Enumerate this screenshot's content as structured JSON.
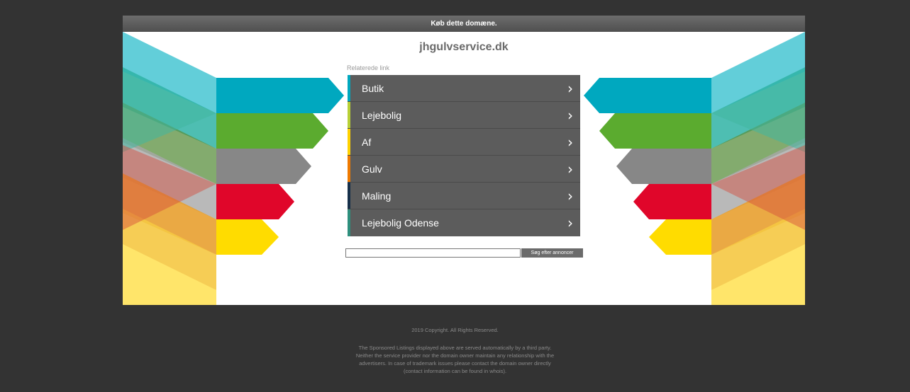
{
  "header": {
    "buy_text": "Køb dette domæne."
  },
  "domain": "jhgulvservice.dk",
  "related": {
    "label": "Relaterede link",
    "items": [
      {
        "label": "Butik",
        "color": "#00a8bf"
      },
      {
        "label": "Lejebolig",
        "color": "#b8d035"
      },
      {
        "label": "Af",
        "color": "#ffd200"
      },
      {
        "label": "Gulv",
        "color": "#ef7a00"
      },
      {
        "label": "Maling",
        "color": "#16304a"
      },
      {
        "label": "Lejebolig Odense",
        "color": "#2e8f7d"
      }
    ]
  },
  "search": {
    "value": "",
    "button_label": "Søg efter annoncer"
  },
  "footer": {
    "copyright": "2019 Copyright. All Rights Reserved.",
    "disclaimer": "The Sponsored Listings displayed above are served automatically by a third party. Neither the service provider nor the domain owner maintain any relationship with the advertisers. In case of trademark issues please contact the domain owner directly (contact information can be found in whois)."
  },
  "colors": {
    "background": "#333333",
    "teal": "#00a8bf",
    "green": "#5bab2f",
    "grey": "#878787",
    "red": "#e0062a",
    "yellow": "#ffdc00"
  }
}
